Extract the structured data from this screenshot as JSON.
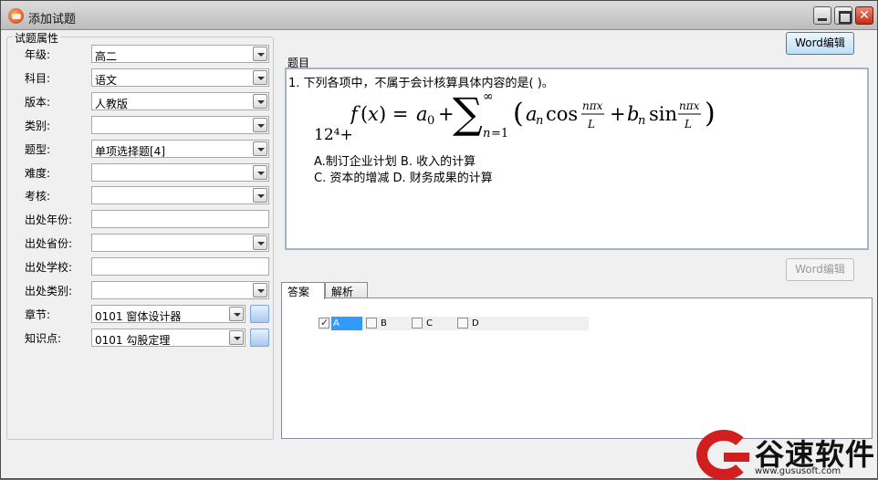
{
  "window": {
    "title": "添加试题"
  },
  "left": {
    "group_title": "试题属性",
    "fields": [
      {
        "label": "年级:",
        "value": "高二",
        "type": "combo"
      },
      {
        "label": "科目:",
        "value": "语文",
        "type": "combo"
      },
      {
        "label": "版本:",
        "value": "人教版",
        "type": "combo"
      },
      {
        "label": "类别:",
        "value": "",
        "type": "combo"
      },
      {
        "label": "题型:",
        "value": "单项选择题[4]",
        "type": "combo"
      },
      {
        "label": "难度:",
        "value": "",
        "type": "combo"
      },
      {
        "label": "考核:",
        "value": "",
        "type": "combo"
      },
      {
        "label": "出处年份:",
        "value": "",
        "type": "text"
      },
      {
        "label": "出处省份:",
        "value": "",
        "type": "combo"
      },
      {
        "label": "出处学校:",
        "value": "",
        "type": "text"
      },
      {
        "label": "出处类别:",
        "value": "",
        "type": "combo"
      },
      {
        "label": "章节:",
        "value": "0101 窗体设计器",
        "type": "combo-pick"
      },
      {
        "label": "知识点:",
        "value": "0101 勾股定理",
        "type": "combo-pick"
      }
    ]
  },
  "right": {
    "word_edit_label": "Word编辑",
    "word_edit_disabled_label": "Word编辑",
    "question_section_label": "题目",
    "question_line": "1.  下列各项中，不属于会计核算具体内容的是(    )。",
    "formula_prefix": "12⁴+",
    "options_line1": "A.制订企业计划    B. 收入的计算",
    "options_line2": "C. 资本的增减    D. 财务成果的计算",
    "tabs": [
      "答案",
      "解析"
    ],
    "answers": [
      {
        "label": "A",
        "checked": true
      },
      {
        "label": "B",
        "checked": false
      },
      {
        "label": "C",
        "checked": false
      },
      {
        "label": "D",
        "checked": false
      }
    ]
  },
  "watermark": {
    "text": "谷速软件",
    "url": "www.gususoft.com"
  },
  "colors": {
    "watermark_red": "#d11f1f",
    "selection_blue": "#3399ff"
  }
}
